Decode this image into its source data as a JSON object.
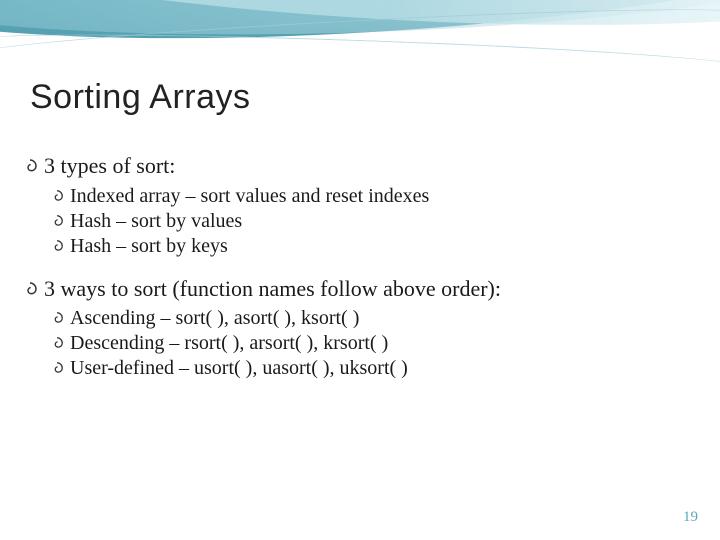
{
  "title": "Sorting Arrays",
  "outline": {
    "section1": {
      "heading": "3 types of sort:",
      "items": [
        "Indexed array – sort values and reset indexes",
        "Hash – sort by values",
        "Hash – sort by keys"
      ]
    },
    "section2": {
      "heading": "3 ways to sort (function names follow above order):",
      "items": [
        "Ascending – sort( ), asort( ), ksort( )",
        "Descending – rsort( ), arsort( ), krsort( )",
        "User-defined – usort( ), uasort( ), uksort( )"
      ]
    }
  },
  "slide_number": "19",
  "colors": {
    "swoosh_primary": "#4a9db0",
    "swoosh_light": "#bfe3ea",
    "page_number": "#5aa6b6"
  },
  "icons": {
    "bullet": "swirl-icon"
  }
}
